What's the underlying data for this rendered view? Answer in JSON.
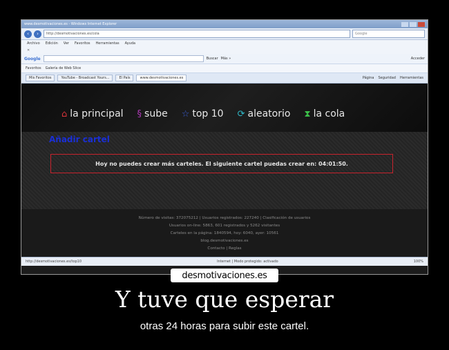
{
  "browser": {
    "window_title": "www.desmotivaciones.es - Windows Internet Explorer",
    "address": "http://desmotivaciones.es/cola",
    "search_placeholder": "Google",
    "menu": [
      "Archivo",
      "Edición",
      "Ver",
      "Favoritos",
      "Herramientas",
      "Ayuda"
    ],
    "google_label": "Google",
    "google_buttons": [
      "Buscar",
      "Más »"
    ],
    "google_right": "Acceder",
    "favorites_label": "Favoritos",
    "favorites_items": [
      "Galería de Web Slice"
    ],
    "tabs": [
      "Mis Favoritos",
      "YouTube - Broadcast Yours...",
      "El País",
      "www.desmotivaciones.es"
    ],
    "tab_tools": [
      "Página",
      "Seguridad",
      "Herramientas"
    ],
    "status_left": "http://desmotivaciones.es/top10",
    "status_right": "Internet | Modo protegido: activado",
    "zoom": "100%"
  },
  "site": {
    "nav": [
      {
        "label": "la principal",
        "icon": "home-icon"
      },
      {
        "label": "sube",
        "icon": "upload-icon"
      },
      {
        "label": "top 10",
        "icon": "star-icon"
      },
      {
        "label": "aleatorio",
        "icon": "shuffle-icon"
      },
      {
        "label": "la cola",
        "icon": "hourglass-icon"
      }
    ],
    "add_title": "Añadir cartel",
    "warning": "Hoy no puedes crear más carteles. El siguiente cartel puedas crear en: 04:01:50.",
    "footer_lines": [
      "Número de visitas: 372075212 | Usuarios registrados: 227240 | Clasificación de usuarios",
      "Usuarios on-line: 5863, 601 registrados y 5262 visitantes",
      "Carteles en la página: 1840594, hoy: 6040, ayer: 10561",
      "blog.desmotivaciones.es",
      "Contacto | Reglas"
    ]
  },
  "watermark": "desmotivaciones.es",
  "caption": {
    "title": "Y tuve que esperar",
    "subtitle": "otras 24 horas para subir este cartel."
  }
}
